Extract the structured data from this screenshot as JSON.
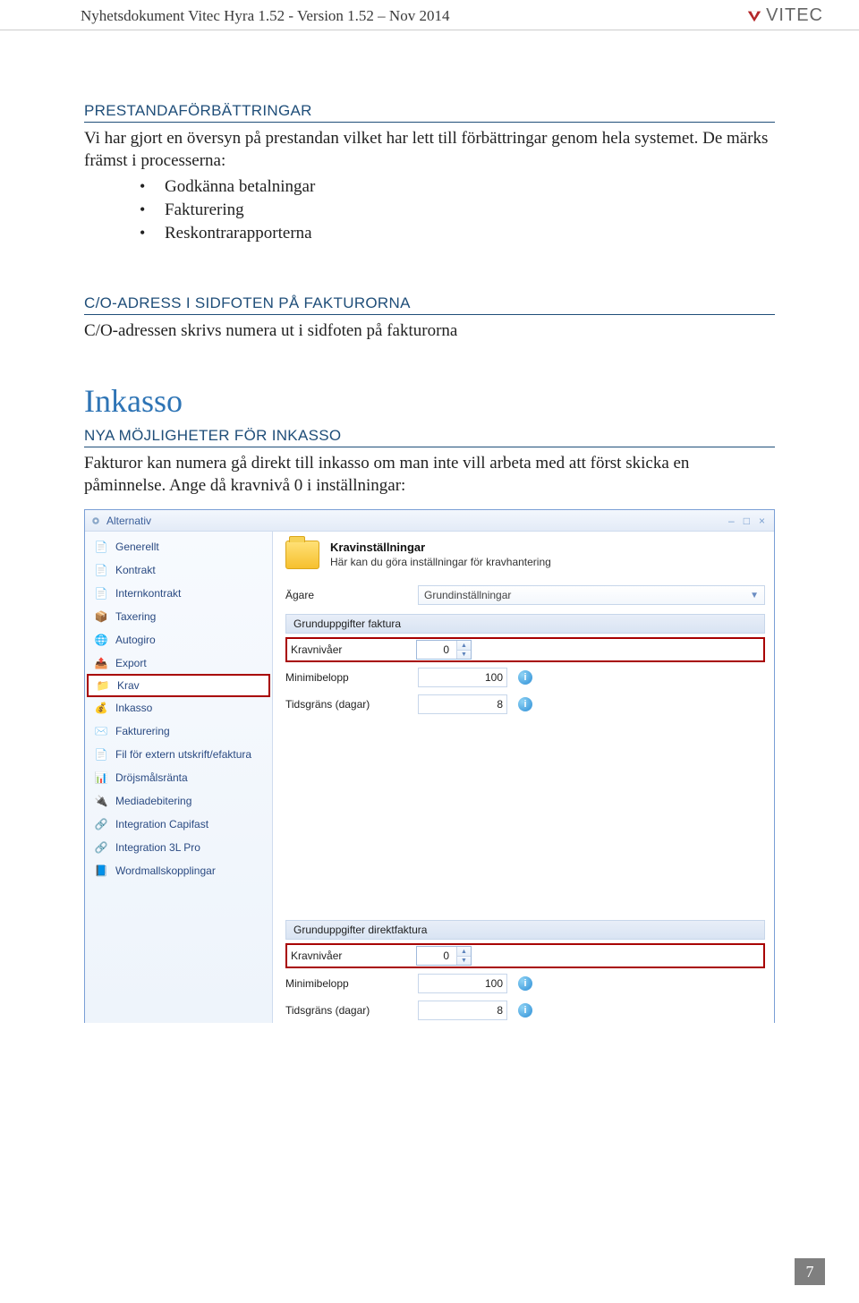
{
  "header": {
    "title": "Nyhetsdokument Vitec Hyra 1.52 - Version 1.52 – Nov 2014",
    "logo_text": "VITEC"
  },
  "sections": {
    "prestanda": {
      "heading": "PRESTANDAFÖRBÄTTRINGAR",
      "para": "Vi har gjort en översyn på prestandan vilket har lett till förbättringar genom hela systemet. De märks främst i processerna:",
      "bullets": [
        "Godkänna betalningar",
        "Fakturering",
        "Reskontrarapporterna"
      ]
    },
    "coadress": {
      "heading": "C/O-ADRESS I SIDFOTEN PÅ FAKTURORNA",
      "para": "C/O-adressen skrivs numera ut i sidfoten på fakturorna"
    },
    "inkasso": {
      "title": "Inkasso",
      "sub_heading": "NYA MÖJLIGHETER FÖR INKASSO",
      "para": "Fakturor kan numera gå direkt till inkasso om man inte vill arbeta med att först skicka en påminnelse. Ange då kravnivå 0 i inställningar:"
    }
  },
  "screenshot": {
    "window_title": "Alternativ",
    "sidebar": {
      "items": [
        {
          "label": "Generellt"
        },
        {
          "label": "Kontrakt"
        },
        {
          "label": "Internkontrakt"
        },
        {
          "label": "Taxering"
        },
        {
          "label": "Autogiro"
        },
        {
          "label": "Export"
        },
        {
          "label": "Krav",
          "selected": true
        },
        {
          "label": "Inkasso"
        },
        {
          "label": "Fakturering"
        },
        {
          "label": "Fil för extern utskrift/efaktura"
        },
        {
          "label": "Dröjsmålsränta"
        },
        {
          "label": "Mediadebitering"
        },
        {
          "label": "Integration Capifast"
        },
        {
          "label": "Integration 3L Pro"
        },
        {
          "label": "Wordmallskopplingar"
        }
      ]
    },
    "panel": {
      "title": "Kravinställningar",
      "subtitle": "Här kan du göra inställningar för kravhantering",
      "owner_label": "Ägare",
      "owner_value": "Grundinställningar",
      "group1": "Grunduppgifter faktura",
      "group2": "Grunduppgifter direktfaktura",
      "fields": {
        "kravnivaer_label": "Kravnivåer",
        "kravnivaer_value": "0",
        "minimibelopp_label": "Minimibelopp",
        "minimibelopp_value": "100",
        "tidsgrans_label": "Tidsgräns (dagar)",
        "tidsgrans_value": "8"
      }
    }
  },
  "page_number": "7"
}
